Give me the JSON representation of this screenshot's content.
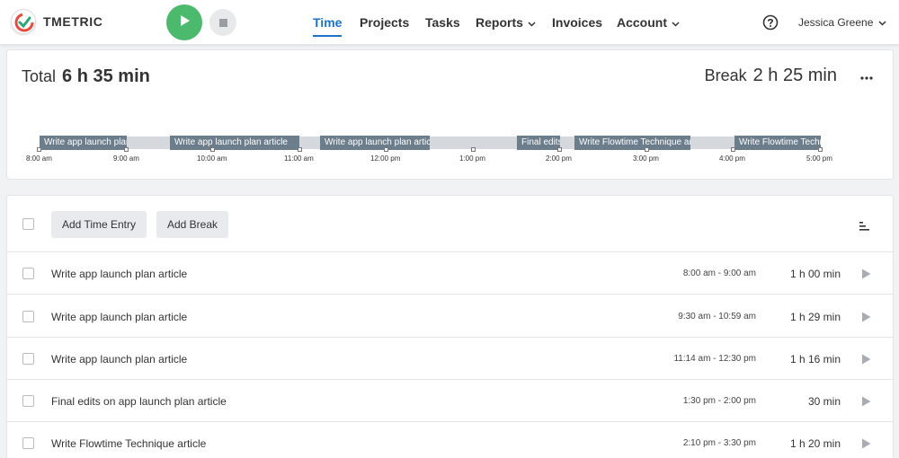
{
  "app": {
    "name": "TMETRIC"
  },
  "nav": {
    "time": "Time",
    "projects": "Projects",
    "tasks": "Tasks",
    "reports": "Reports",
    "invoices": "Invoices",
    "account": "Account"
  },
  "user": {
    "name": "Jessica Greene"
  },
  "summary": {
    "total_label": "Total",
    "total_value": "6 h 35 min",
    "break_label": "Break",
    "break_value": "2 h 25 min"
  },
  "timeline": {
    "segments": [
      "Write app launch plan article",
      "Write app launch plan article",
      "Write app launch plan article",
      "Final edits on app launch plan article",
      "Write Flowtime Technique article",
      "Write Flowtime Technique article"
    ],
    "hours": [
      "8:00 am",
      "9:00 am",
      "10:00 am",
      "11:00 am",
      "12:00 pm",
      "1:00 pm",
      "2:00 pm",
      "3:00 pm",
      "4:00 pm",
      "5:00 pm"
    ]
  },
  "toolbar": {
    "add_time_entry": "Add Time Entry",
    "add_break": "Add Break"
  },
  "entries": [
    {
      "description": "Write app launch plan article",
      "range": "8:00 am - 9:00 am",
      "duration": "1 h 00 min"
    },
    {
      "description": "Write app launch plan article",
      "range": "9:30 am - 10:59 am",
      "duration": "1 h 29 min"
    },
    {
      "description": "Write app launch plan article",
      "range": "11:14 am - 12:30 pm",
      "duration": "1 h 16 min"
    },
    {
      "description": "Final edits on app launch plan article",
      "range": "1:30 pm - 2:00 pm",
      "duration": "30 min"
    },
    {
      "description": "Write Flowtime Technique article",
      "range": "2:10 pm - 3:30 pm",
      "duration": "1 h 20 min"
    }
  ],
  "colors": {
    "accent": "#1a73c8",
    "start_button": "#4cba6c",
    "timeline_segment": "#6c7d8c",
    "timeline_track": "#d5d9de"
  }
}
